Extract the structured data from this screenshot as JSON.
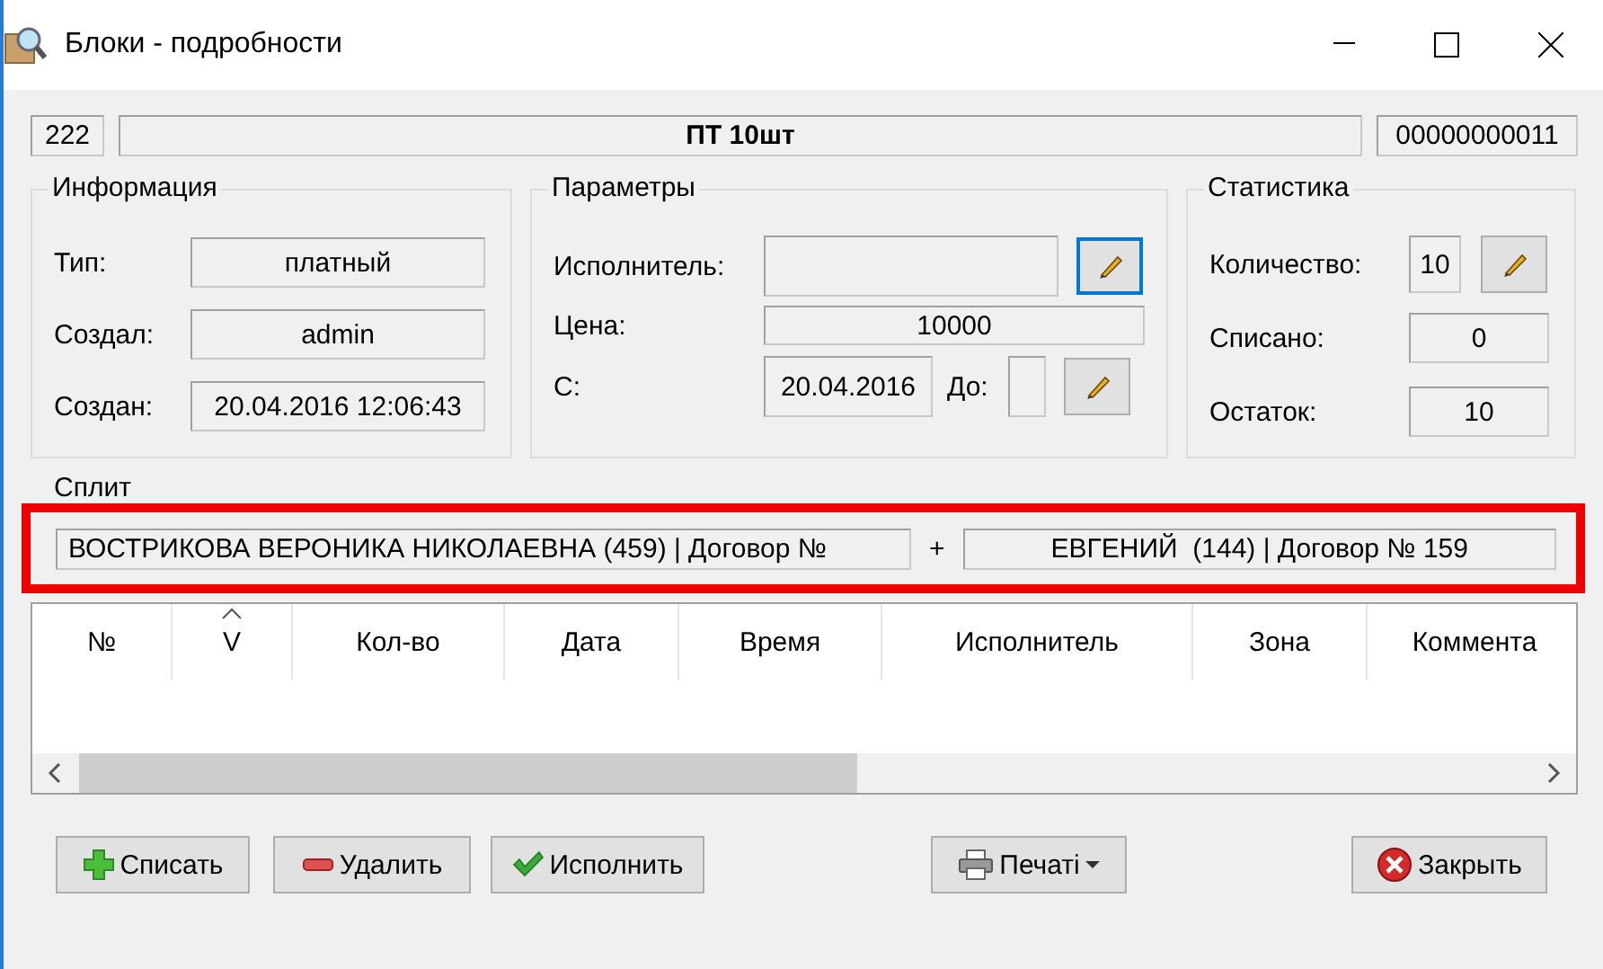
{
  "window": {
    "title": "Блоки - подробности"
  },
  "header": {
    "number": "222",
    "name": "ПТ 10шт",
    "code": "00000000011"
  },
  "info": {
    "title": "Информация",
    "fields": [
      {
        "label": "Тип:",
        "value": "платный"
      },
      {
        "label": "Создал:",
        "value": "admin"
      },
      {
        "label": "Создан:",
        "value": "20.04.2016 12:06:43"
      }
    ]
  },
  "params": {
    "title": "Параметры",
    "executor_label": "Исполнитель:",
    "executor_edit": {
      "focused": true
    },
    "price_label": "Цена:",
    "price": "10000",
    "from_label": "С:",
    "from": "20.04.2016",
    "to_label": "До:",
    "period_edit": {
      "focused": false
    }
  },
  "stats": {
    "title": "Статистика",
    "rows": [
      {
        "label": "Количество:",
        "value": "10",
        "kind": "editable"
      },
      {
        "label": "Списано:",
        "value": "0",
        "kind": "plain"
      },
      {
        "label": "Остаток:",
        "value": "10",
        "kind": "plain"
      }
    ]
  },
  "split": {
    "title": "Сплит",
    "highlighted": true,
    "left": "ВОСТРИКОВА ВЕРОНИКА НИКОЛАЕВНА (459) | Договор №",
    "joiner": "+",
    "right": "ЕВГЕНИЙ  (144) | Договор № 159"
  },
  "table": {
    "columns": [
      {
        "label": "№",
        "sorted": false
      },
      {
        "label": "V",
        "sorted": true
      },
      {
        "label": "Кол-во",
        "sorted": false
      },
      {
        "label": "Дата",
        "sorted": false
      },
      {
        "label": "Время",
        "sorted": false
      },
      {
        "label": "Исполнитель",
        "sorted": false
      },
      {
        "label": "Зона",
        "sorted": false
      },
      {
        "label": "Коммента",
        "sorted": false
      }
    ]
  },
  "buttons": [
    {
      "label": "Списать",
      "kind": "add",
      "dropdown": false
    },
    {
      "label": "Удалить",
      "kind": "remove",
      "dropdown": false
    },
    {
      "label": "Исполнить",
      "kind": "complete",
      "dropdown": false
    },
    {
      "label": "Печаті",
      "kind": "print",
      "dropdown": true
    },
    {
      "label": "Закрыть",
      "kind": "close",
      "dropdown": false
    }
  ]
}
